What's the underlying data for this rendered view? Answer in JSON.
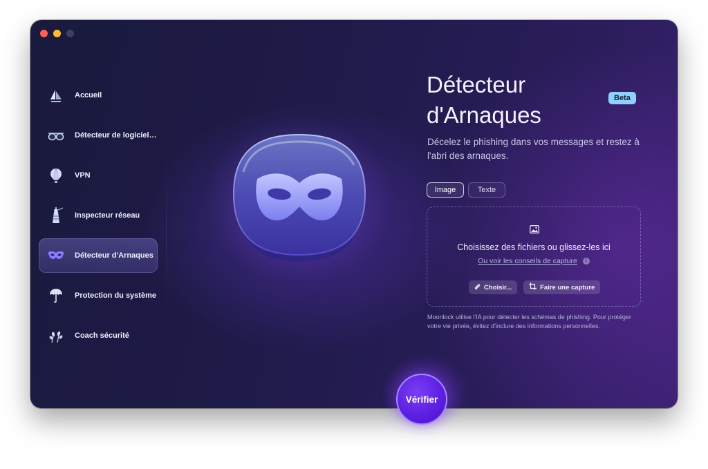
{
  "sidebar": {
    "items": [
      {
        "label": "Accueil",
        "icon": "sailboat-icon"
      },
      {
        "label": "Détecteur de logiciels malveillants",
        "icon": "glasses-icon"
      },
      {
        "label": "VPN",
        "icon": "hot-air-balloon-icon"
      },
      {
        "label": "Inspecteur réseau",
        "icon": "lighthouse-icon"
      },
      {
        "label": "Détecteur d'Arnaques",
        "icon": "mask-icon",
        "active": true
      },
      {
        "label": "Protection du système",
        "icon": "umbrella-icon"
      },
      {
        "label": "Coach sécurité",
        "icon": "wheat-icon"
      }
    ]
  },
  "main": {
    "title": "Détecteur d'Arnaques",
    "badge": "Beta",
    "subtitle": "Décelez le phishing dans vos messages et restez à l'abri des arnaques.",
    "tabs": [
      {
        "label": "Image",
        "selected": true
      },
      {
        "label": "Texte",
        "selected": false
      }
    ],
    "dropzone": {
      "icon": "image-icon",
      "text": "Choisissez des fichiers ou glissez-les ici",
      "link": "Ou voir les conseils de capture",
      "choose_button": "Choisir...",
      "capture_button": "Faire une capture"
    },
    "disclaimer": "Moonlock utilise l'IA pour détecter les schémas de phishing. Pour protéger votre vie privée, évitez d'inclure des informations personnelles.",
    "verify_button": "Vérifier"
  },
  "colors": {
    "accent": "#6a2df0",
    "beta_badge": "#8fd0ff",
    "traffic_close": "#ff5f57",
    "traffic_minimize": "#febc2e"
  }
}
